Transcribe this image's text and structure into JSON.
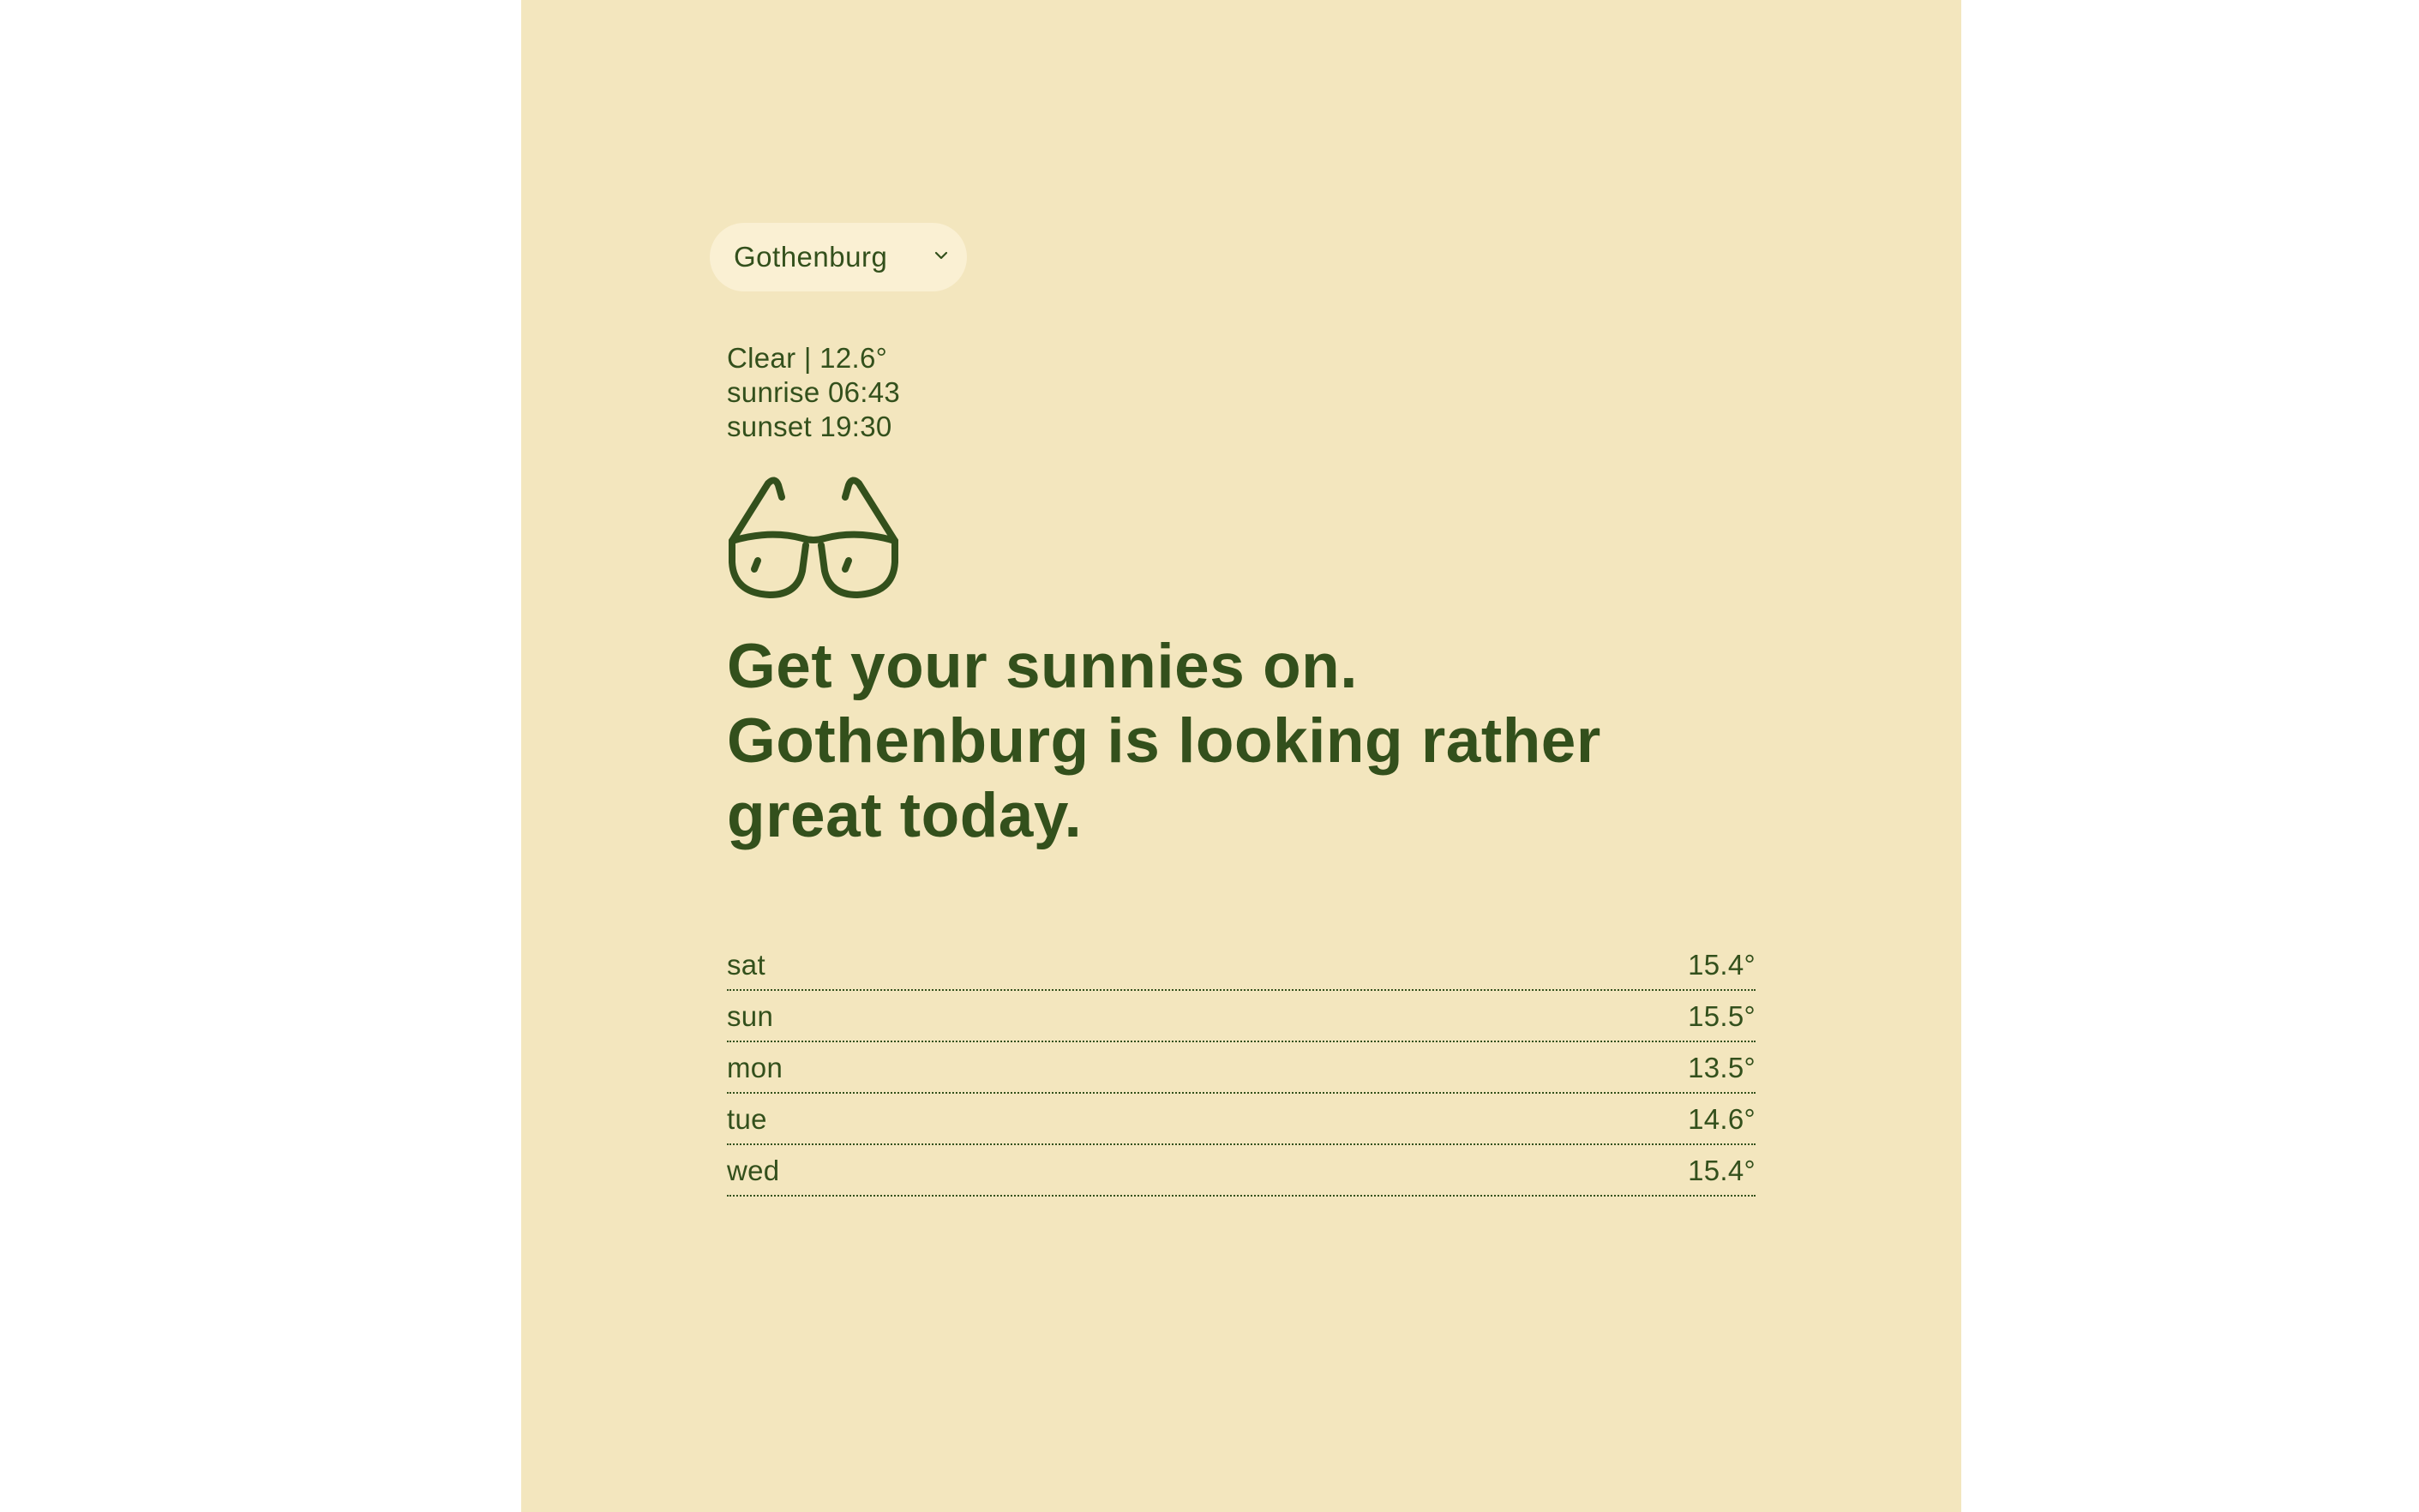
{
  "location": {
    "selected_city": "Gothenburg",
    "dropdown_icon": "chevron-down-icon"
  },
  "current": {
    "condition_line": "Clear | 12.6°",
    "sunrise_line": "sunrise 06:43",
    "sunset_line": "sunset 19:30",
    "icon": "sunglasses-icon"
  },
  "headline": {
    "line1": "Get your sunnies on.",
    "line2": "Gothenburg is looking rather",
    "line3": "great today."
  },
  "forecast": [
    {
      "day": "sat",
      "temp": "15.4°"
    },
    {
      "day": "sun",
      "temp": "15.5°"
    },
    {
      "day": "mon",
      "temp": "13.5°"
    },
    {
      "day": "tue",
      "temp": "14.6°"
    },
    {
      "day": "wed",
      "temp": "15.4°"
    }
  ],
  "colors": {
    "background": "#f3e6be",
    "select_background": "#faf0d3",
    "text": "#33501c",
    "page": "#ffffff"
  }
}
